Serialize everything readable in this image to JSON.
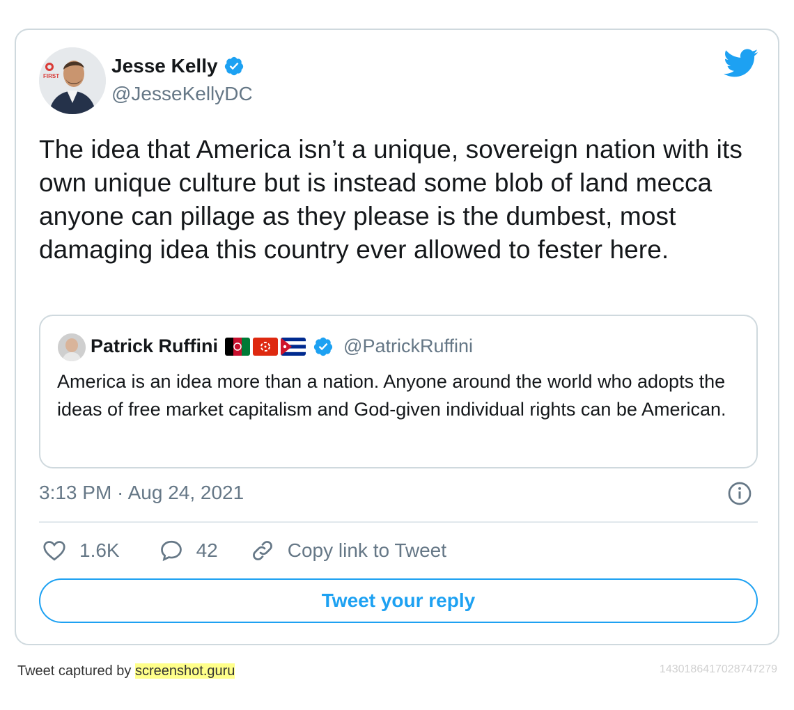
{
  "tweet": {
    "author_name": "Jesse Kelly",
    "author_handle": "@JesseKellyDC",
    "text": "The idea that America isn’t a unique, sovereign nation with its own unique culture but is instead some blob of land mecca anyone can pillage as they please is the dumbest, most damaging idea this country ever allowed to fester here.",
    "timestamp": "3:13 PM · Aug 24, 2021",
    "avatar_logo_text": "FIRST"
  },
  "quoted": {
    "author_name": "Patrick Ruffini",
    "author_handle": "@PatrickRuffini",
    "text": "America is an idea more than a nation. Anyone around the world who adopts the ideas of free market capitalism and God-given individual rights can be American.",
    "flags": [
      "afghanistan-flag",
      "hong-kong-flag",
      "cuba-flag"
    ]
  },
  "actions": {
    "like_count": "1.6K",
    "reply_count": "42",
    "copy_link_label": "Copy link to Tweet",
    "reply_button_label": "Tweet your reply"
  },
  "footer": {
    "captured_by": "Tweet captured by",
    "site": "screenshot.guru",
    "tweet_id": "1430186417028747279"
  },
  "colors": {
    "twitter_blue": "#1da1f2",
    "text_primary": "#14171a",
    "text_secondary": "#657786",
    "border": "#cfd9de",
    "highlight": "#ffff8a"
  },
  "icons": {
    "brand": "twitter-bird-icon",
    "verified": "verified-badge-icon",
    "info": "info-icon",
    "like": "heart-icon",
    "reply": "speech-bubble-icon",
    "copy_link": "link-icon"
  }
}
